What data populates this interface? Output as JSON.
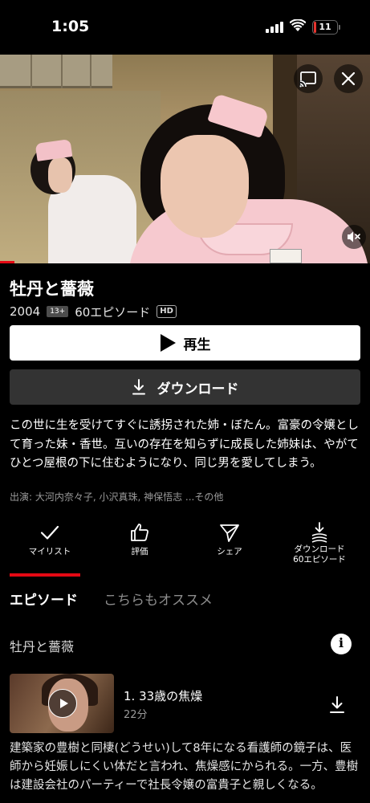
{
  "status_bar": {
    "time": "1:05",
    "battery": "11",
    "battery_level": 0.11,
    "battery_color": "#e5342e"
  },
  "video": {
    "progress": 0.04,
    "progress_color": "#e50914",
    "icons": [
      "cast-icon",
      "close-icon",
      "mute-icon"
    ]
  },
  "show": {
    "title": "牡丹と薔薇",
    "year": "2004",
    "rating": "13+",
    "episodes": "60エピソード",
    "quality": "HD"
  },
  "buttons": {
    "play": "再生",
    "download": "ダウンロード"
  },
  "synopsis": "この世に生を受けてすぐに誘拐された姉・ぼたん。富豪の令嬢として育った妹・香世。互いの存在を知らずに成長した姉妹は、やがてひとつ屋根の下に住むようになり、同じ男を愛してしまう。",
  "cast": "出演: 大河内奈々子, 小沢真珠, 神保悟志 ...その他",
  "actions": {
    "my_list": "マイリスト",
    "rate": "評価",
    "share": "シェア",
    "download_line1": "ダウンロード",
    "download_line2": "60エピソード"
  },
  "tabs": {
    "episodes": "エピソード",
    "more_like_this": "こちらもオススメ"
  },
  "season": {
    "title": "牡丹と薔薇"
  },
  "episode": {
    "title": "1. 33歳の焦燥",
    "duration": "22分",
    "description": "建築家の豊樹と同棲(どうせい)して8年になる看護師の鏡子は、医師から妊娠しにくい体だと言われ、焦燥感にかられる。一方、豊樹は建設会社のパーティーで社長令嬢の富貴子と親しくなる。"
  }
}
